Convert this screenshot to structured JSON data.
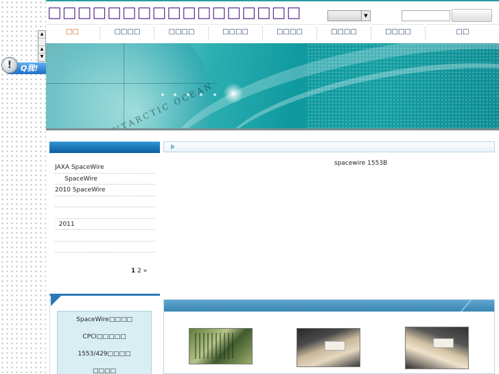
{
  "header": {
    "site_title": "□□□□□□□□□□□□□□□□□",
    "language_select": "",
    "search_placeholder": "",
    "search_button": ""
  },
  "nav": {
    "items": [
      {
        "label": "□□"
      },
      {
        "label": "□□□□"
      },
      {
        "label": "□□□□"
      },
      {
        "label": "□□□□"
      },
      {
        "label": "□□□□"
      },
      {
        "label": "□□□□"
      },
      {
        "label": "□□□□"
      },
      {
        "label": "□□"
      }
    ]
  },
  "qq_widget": {
    "label": "Q我!"
  },
  "banner": {
    "arc_text": "ANTARCTIC OCEAN"
  },
  "news": {
    "items": [
      "JAXA      SpaceWire",
      "     SpaceWire",
      "2010  SpaceWire",
      "",
      "",
      "  2011",
      "",
      ""
    ],
    "pager": {
      "page1": "1",
      "page2": "2",
      "next": "»"
    }
  },
  "content": {
    "text": "spacewire 1553B"
  },
  "categories": {
    "items": [
      "SpaceWire□□□□",
      "CPCI□□□□□",
      "1553/429□□□□",
      "□□□□"
    ]
  },
  "colors": {
    "accent": "#2a79b9",
    "title": "#5a2d8c",
    "nav_active": "#d25a00",
    "banner_teal": "#0f9aa0"
  }
}
